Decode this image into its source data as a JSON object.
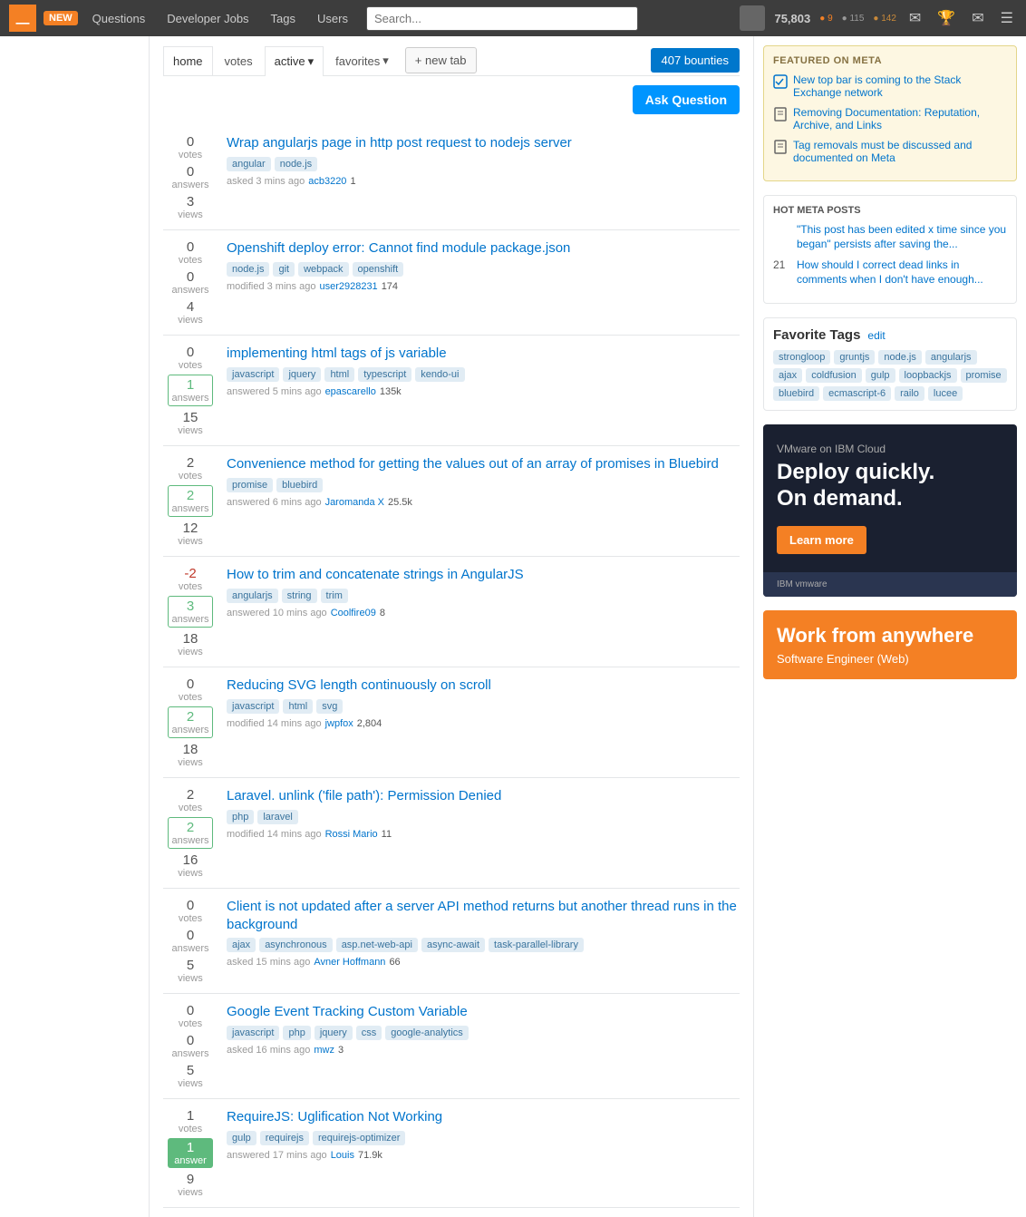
{
  "topbar": {
    "logo_alt": "Stack Overflow",
    "new_badge": "NEW",
    "nav_items": [
      {
        "label": "Questions",
        "id": "questions"
      },
      {
        "label": "Developer Jobs",
        "id": "developer-jobs"
      },
      {
        "label": "Tags",
        "id": "tags"
      },
      {
        "label": "Users",
        "id": "users"
      }
    ],
    "search_placeholder": "Search...",
    "user_rep": "75,803",
    "gold_count": "9",
    "silver_count": "115",
    "bronze_count": "142"
  },
  "filter_tabs": [
    {
      "label": "home",
      "id": "home",
      "active": true
    },
    {
      "label": "votes",
      "id": "votes"
    },
    {
      "label": "active",
      "id": "active"
    },
    {
      "label": "favorites",
      "id": "favorites"
    }
  ],
  "new_tab_label": "+ new tab",
  "bounties_label": "407 bounties",
  "ask_question_label": "Ask Question",
  "questions": [
    {
      "votes": "0",
      "answers": "0",
      "views": "3",
      "answer_state": "none",
      "title": "Wrap angularjs page in http post request to nodejs server",
      "tags": [
        "angular",
        "node.js"
      ],
      "meta": "asked 3 mins ago",
      "user": "acb3220",
      "user_rep": "1"
    },
    {
      "votes": "0",
      "answers": "0",
      "views": "4",
      "answer_state": "none",
      "title": "Openshift deploy error: Cannot find module package.json",
      "tags": [
        "node.js",
        "git",
        "webpack",
        "openshift"
      ],
      "meta": "modified 3 mins ago",
      "user": "user2928231",
      "user_rep": "174"
    },
    {
      "votes": "0",
      "answers": "1",
      "views": "15",
      "answer_state": "has-answer",
      "title": "implementing html tags of js variable",
      "tags": [
        "javascript",
        "jquery",
        "html",
        "typescript",
        "kendo-ui"
      ],
      "meta": "answered 5 mins ago",
      "user": "epascarello",
      "user_rep": "135k"
    },
    {
      "votes": "2",
      "answers": "2",
      "views": "12",
      "answer_state": "has-answer",
      "title": "Convenience method for getting the values out of an array of promises in Bluebird",
      "tags": [
        "promise",
        "bluebird"
      ],
      "meta": "answered 6 mins ago",
      "user": "Jaromanda X",
      "user_rep": "25.5k"
    },
    {
      "votes": "-2",
      "answers": "3",
      "views": "18",
      "answer_state": "has-answer",
      "title": "How to trim and concatenate strings in AngularJS",
      "tags": [
        "angularjs",
        "string",
        "trim"
      ],
      "meta": "answered 10 mins ago",
      "user": "Coolfire09",
      "user_rep": "8"
    },
    {
      "votes": "0",
      "answers": "2",
      "views": "18",
      "answer_state": "has-answer",
      "title": "Reducing SVG length continuously on scroll",
      "tags": [
        "javascript",
        "html",
        "svg"
      ],
      "meta": "modified 14 mins ago",
      "user": "jwpfox",
      "user_rep": "2,804"
    },
    {
      "votes": "2",
      "answers": "2",
      "views": "16",
      "answer_state": "has-answer",
      "title": "Laravel. unlink ('file path'): Permission Denied",
      "tags": [
        "php",
        "laravel"
      ],
      "meta": "modified 14 mins ago",
      "user": "Rossi Mario",
      "user_rep": "11"
    },
    {
      "votes": "0",
      "answers": "0",
      "views": "5",
      "answer_state": "none",
      "title": "Client is not updated after a server API method returns but another thread runs in the background",
      "tags": [
        "ajax",
        "asynchronous",
        "asp.net-web-api",
        "async-await",
        "task-parallel-library"
      ],
      "meta": "asked 15 mins ago",
      "user": "Avner Hoffmann",
      "user_rep": "66"
    },
    {
      "votes": "0",
      "answers": "0",
      "views": "5",
      "answer_state": "none",
      "title": "Google Event Tracking Custom Variable",
      "tags": [
        "javascript",
        "php",
        "jquery",
        "css",
        "google-analytics"
      ],
      "meta": "asked 16 mins ago",
      "user": "mwz",
      "user_rep": "3"
    },
    {
      "votes": "1",
      "answers": "1",
      "views": "9",
      "answer_state": "accepted",
      "title": "RequireJS: Uglification Not Working",
      "tags": [
        "gulp",
        "requirejs",
        "requirejs-optimizer"
      ],
      "meta": "answered 17 mins ago",
      "user": "Louis",
      "user_rep": "71.9k"
    }
  ],
  "sidebar": {
    "featured_on_meta_title": "FEATURED ON META",
    "meta_items": [
      {
        "icon": "checkbox",
        "text": "New top bar is coming to the Stack Exchange network"
      },
      {
        "icon": "book",
        "text": "Removing Documentation: Reputation, Archive, and Links"
      },
      {
        "icon": "book",
        "text": "Tag removals must be discussed and documented on Meta"
      }
    ],
    "hot_meta_title": "HOT META POSTS",
    "hot_meta_items": [
      {
        "num": "",
        "text": "\"This post has been edited x time since you began\" persists after saving the..."
      },
      {
        "num": "21",
        "text": "How should I correct dead links in comments when I don't have enough..."
      }
    ],
    "fav_tags_title": "Favorite Tags",
    "edit_label": "edit",
    "fav_tags": [
      "strongloop",
      "gruntjs",
      "node.js",
      "angularjs",
      "ajax",
      "coldfusion",
      "gulp",
      "loopbackjs",
      "promise",
      "bluebird",
      "ecmascript-6",
      "railo",
      "lucee"
    ],
    "ad_brand": "VMware on IBM Cloud",
    "ad_headline": "Deploy quickly.\nOn demand.",
    "ad_learn_more": "Learn more",
    "ad_footer_brand": "IBM vmware",
    "work_title": "Work from anywhere",
    "work_sub": "Software Engineer (Web)"
  }
}
